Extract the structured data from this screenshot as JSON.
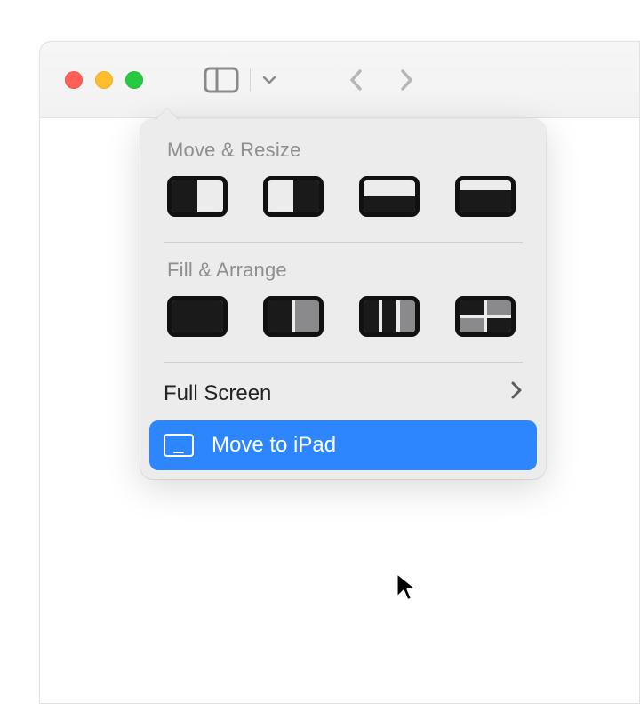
{
  "colors": {
    "highlight": "#2e86ff",
    "titlebar_bg": "#f4f4f4",
    "popover_bg": "#ececec"
  },
  "popover": {
    "section_move_resize": "Move & Resize",
    "section_fill_arrange": "Fill & Arrange",
    "fullscreen_label": "Full Screen",
    "move_to_ipad_label": "Move to iPad"
  }
}
